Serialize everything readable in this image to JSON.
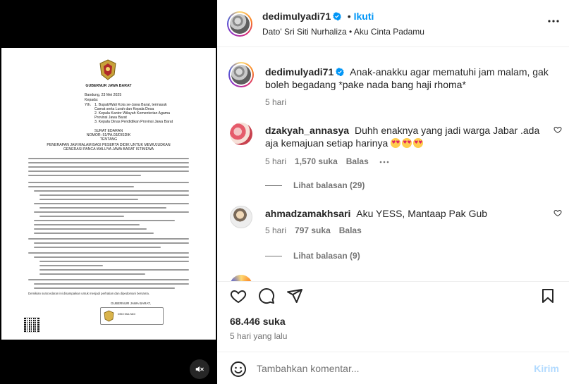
{
  "post": {
    "username": "dedimulyadi71",
    "follow_label": "Ikuti",
    "audio": "Dato' Sri Siti Nurhaliza • Aku Cinta Padamu",
    "caption": "Anak-anakku agar mematuhi jam malam, gak boleh begadang *pake nada bang haji rhoma*",
    "caption_time": "5 hari",
    "likes": "68.446 suka",
    "posted": "5 hari yang lalu"
  },
  "comments": [
    {
      "username": "dzakyah_annasya",
      "text": "Duhh enaknya yang jadi warga Jabar .ada aja kemajuan setiap harinya",
      "emoji_count": 3,
      "time": "5 hari",
      "likes": "1,570 suka",
      "reply": "Balas",
      "replies": "Lihat balasan (29)"
    },
    {
      "username": "ahmadzamakhsari",
      "text": "Aku YESS, Mantaap Pak Gub",
      "time": "5 hari",
      "likes": "797 suka",
      "reply": "Balas",
      "replies": "Lihat balasan (9)"
    }
  ],
  "compose": {
    "placeholder": "Tambahkan komentar...",
    "send_label": "Kirim"
  },
  "letter": {
    "heading": "GUBERNUR JAWA BARAT",
    "date": "Bandung, 23 Mei 2025",
    "kepada_label": "Kepada:",
    "yth_label": "Yth.",
    "recipients": [
      "1.    Bupati/Wali Kota se-Jawa Barat, termasuk",
      "       Camat serta Lurah dan Kepala Desa",
      "2.    Kepala Kantor Wilayah Kementerian Agama",
      "       Provinsi Jawa Barat",
      "3.    Kepala Dinas Pendidikan Provinsi Jawa Barat"
    ],
    "doc_type": "SURAT EDARAN",
    "number": "NOMOR: 51/PA.03/DISDIK",
    "tentang": "TENTANG",
    "subject_1": "PENERAPAN JAM MALAM BAGI PESERTA DIDIK UNTUK MEWUJUDKAN",
    "subject_2": "GENERASI PANCA WALUYA JAWA BARAT ISTIMEWA",
    "closing": "Demikian surat edaran ini disampaikan untuk menjadi perhatian dan dipedomani bersama.",
    "sign_title_1": "GUBERNUR JAWA BARAT,",
    "sign_name": "DEDI MULYADI"
  },
  "icons": {
    "verified": "verified-badge-icon",
    "more": "more-options-icon",
    "like": "heart-icon",
    "comment": "comment-icon",
    "share": "send-icon",
    "save": "bookmark-icon",
    "mute": "muted-speaker-icon",
    "emoji_picker": "smiley-icon"
  },
  "colors": {
    "link_blue": "#0095f6",
    "verified_blue": "#0095f6",
    "send_disabled": "#b3dbff",
    "muted_text": "#737373"
  }
}
